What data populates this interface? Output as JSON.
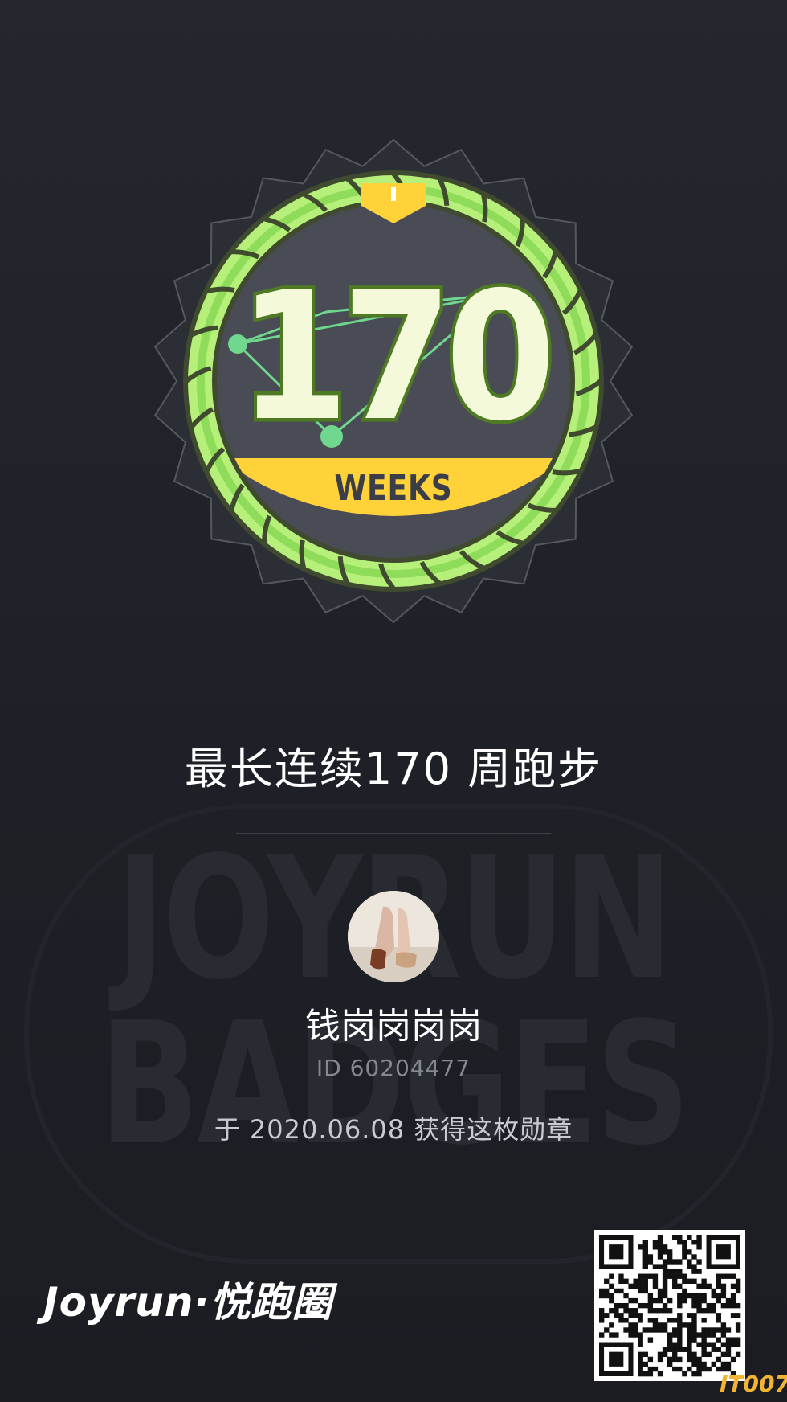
{
  "badge": {
    "number": "170",
    "ribbon_text": "WEEKS",
    "icon": "streak-badge-icon",
    "colors": {
      "rope_light": "#b6f07a",
      "rope_mid": "#8fdc5a",
      "rope_dark": "#3f4a2e",
      "face": "#4a4c55",
      "number_fill": "#f4f9d9",
      "number_stroke": "#4d7a22",
      "ribbon": "#ffd23a",
      "ribbon_text": "#3b3d48",
      "node": "#6fd88e"
    }
  },
  "achievement": {
    "title": "最长连续170 周跑步"
  },
  "user": {
    "avatar_icon": "avatar-icon",
    "name": "钱岗岗岗岗",
    "id_text": "ID 60204477",
    "earned_text": "于 2020.06.08 获得这枚勋章"
  },
  "watermark": {
    "line1": "JOYRUN",
    "line2": "BADGES"
  },
  "footer": {
    "brand": "Joyrun·悦跑圈",
    "qr_icon": "qr-code-icon",
    "corner_mark": "IT007"
  }
}
